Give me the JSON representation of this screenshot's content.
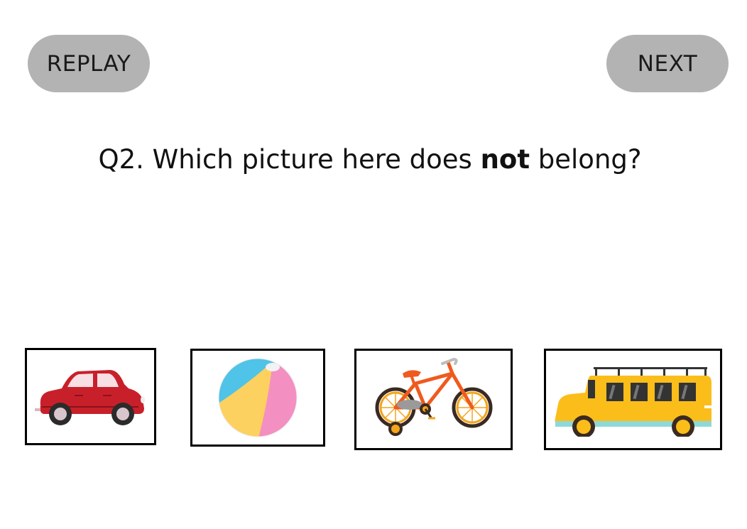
{
  "buttons": {
    "replay_label": "REPLAY",
    "next_label": "NEXT"
  },
  "question": {
    "prefix": "Q2. Which picture here does ",
    "emphasis": "not",
    "suffix": " belong?"
  },
  "options": [
    {
      "id": "car",
      "icon": "car-icon"
    },
    {
      "id": "ball",
      "icon": "beach-ball-icon"
    },
    {
      "id": "bike",
      "icon": "bicycle-icon"
    },
    {
      "id": "bus",
      "icon": "bus-icon"
    }
  ],
  "colors": {
    "button_bg": "#b3b3b3",
    "card_border": "#000000",
    "car_red": "#c8202a",
    "ball_blue": "#4fc3e8",
    "ball_pink": "#f48fc1",
    "ball_yellow": "#fcd15f",
    "bike_orange": "#f05a1e",
    "bus_yellow": "#fbbd19"
  }
}
